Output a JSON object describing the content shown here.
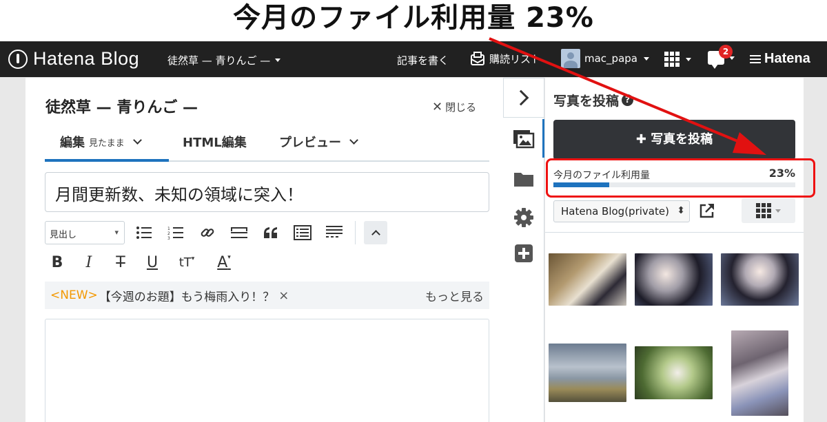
{
  "annotation": {
    "title": "今月のファイル利用量 23%",
    "color": "#e11111"
  },
  "topbar": {
    "logo_text": "Hatena Blog",
    "blog_name": "徒然草 — 青りんご —",
    "write_label": "記事を書く",
    "reader_label": "購読リスト",
    "username": "mac_papa",
    "notification_count": "2",
    "hatena_label": "Hatena"
  },
  "editor": {
    "blog_title": "徒然草 — 青りんご —",
    "close_label": "閉じる",
    "tabs": [
      {
        "label": "編集",
        "sub": "見たまま"
      },
      {
        "label": "HTML編集",
        "sub": ""
      },
      {
        "label": "プレビュー",
        "sub": ""
      }
    ],
    "article_title": "月間更新数、未知の領域に突入！",
    "heading_select": "見出し",
    "notice_new": "<NEW>",
    "notice_text": "【今週のお題】もう梅雨入り！？",
    "notice_more": "もっと見る"
  },
  "photo_panel": {
    "title": "写真を投稿",
    "upload_button": "写真を投稿",
    "usage_label": "今月のファイル利用量",
    "usage_percent": "23%",
    "usage_fraction": 0.23,
    "folder": "Hatena Blog(private)"
  },
  "icons": {
    "strip": [
      "chevron-right-icon",
      "photo-icon",
      "folder-icon",
      "gear-icon",
      "plus-icon"
    ]
  }
}
